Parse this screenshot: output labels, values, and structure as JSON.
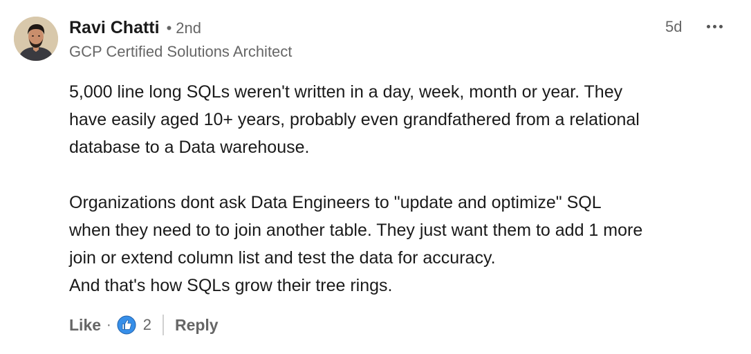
{
  "comment": {
    "author": {
      "name": "Ravi Chatti",
      "separator": "•",
      "degree": "2nd",
      "headline": "GCP Certified Solutions Architect",
      "avatar_icon": "profile-photo"
    },
    "timestamp": "5d",
    "more_icon": "more-options-icon",
    "body_lines": [
      "5,000 line long SQLs weren't written in a day, week, month or year. They",
      "have easily aged 10+ years, probably even grandfathered from a relational",
      "database to a Data warehouse.",
      "",
      "Organizations dont ask Data Engineers to \"update and optimize\" SQL",
      "when they need to to join another table. They just want them to add 1 more",
      "join or extend column list and test the data for accuracy.",
      "And that's how SQLs grow their tree rings."
    ],
    "actions": {
      "like_label": "Like",
      "separator": "·",
      "reaction_icon": "thumbs-up-icon",
      "reaction_count": "2",
      "reply_label": "Reply"
    }
  },
  "colors": {
    "text_primary": "#1a1a1a",
    "text_secondary": "#666666",
    "like_blue": "#378fe9",
    "divider": "#d0d0d0"
  }
}
